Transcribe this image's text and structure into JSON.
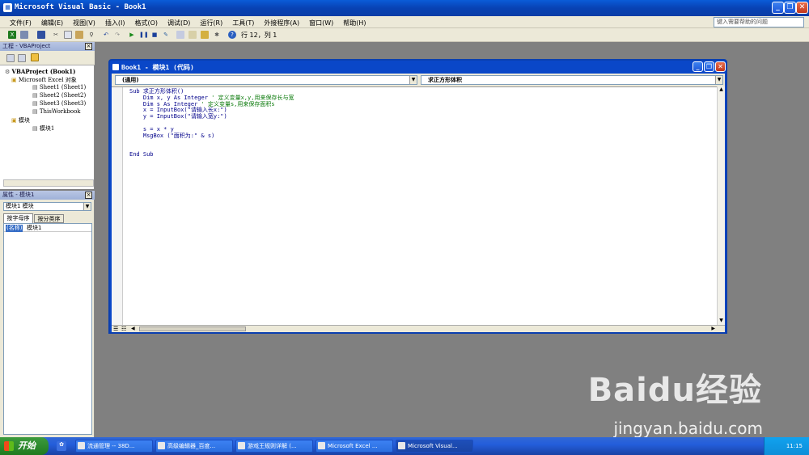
{
  "window": {
    "title": "Microsoft Visual Basic - Book1"
  },
  "menu": [
    "文件(F)",
    "编辑(E)",
    "视图(V)",
    "插入(I)",
    "格式(O)",
    "调试(D)",
    "运行(R)",
    "工具(T)",
    "外接程序(A)",
    "窗口(W)",
    "帮助(H)"
  ],
  "help_placeholder": "键入需要帮助的问题",
  "toolbar": {
    "cursor_pos": "行 12，列 1"
  },
  "project_pane": {
    "title": "工程 - VBAProject",
    "tree": [
      {
        "label": "VBAProject (Book1)",
        "level": 0
      },
      {
        "label": "Microsoft Excel 对象",
        "level": 1
      },
      {
        "label": "Sheet1 (Sheet1)",
        "level": 2
      },
      {
        "label": "Sheet2 (Sheet2)",
        "level": 2
      },
      {
        "label": "Sheet3 (Sheet3)",
        "level": 2
      },
      {
        "label": "ThisWorkbook",
        "level": 2
      },
      {
        "label": "模块",
        "level": 1
      },
      {
        "label": "模块1",
        "level": 2
      }
    ]
  },
  "props_pane": {
    "title": "属性 - 模块1",
    "selector": "模块1 模块",
    "tab_alpha": "按字母序",
    "tab_category": "按分类序",
    "row_name": "(名称)",
    "row_value": "模块1"
  },
  "code_window": {
    "title": "Book1 - 模块1 (代码)",
    "object_combo": "(通用)",
    "proc_combo": "求正方形体积",
    "lines": [
      {
        "code": "Sub 求正方形体积()",
        "comment": ""
      },
      {
        "code": "    Dim x, y As Integer ",
        "comment": "' 定义变量x,y,用来保存长与宽"
      },
      {
        "code": "    Dim s As Integer ",
        "comment": "' 定义变量s,用来保存面积s"
      },
      {
        "code": "    x = InputBox(\"请输入长x:\")",
        "comment": ""
      },
      {
        "code": "    y = InputBox(\"请输入宽y:\")",
        "comment": ""
      },
      {
        "code": "",
        "comment": ""
      },
      {
        "code": "    s = x * y",
        "comment": ""
      },
      {
        "code": "    MsgBox (\"面积为:\" & s)",
        "comment": ""
      },
      {
        "code": "",
        "comment": ""
      },
      {
        "code": "",
        "comment": ""
      },
      {
        "code": "End Sub",
        "comment": ""
      }
    ]
  },
  "watermark": {
    "brand": "Baidu经验",
    "url": "jingyan.baidu.com"
  },
  "taskbar": {
    "start": "开始",
    "tasks": [
      {
        "label": "流通管理 -- 38D...",
        "active": false
      },
      {
        "label": "高级编辑器_百度...",
        "active": false
      },
      {
        "label": "游戏王规则详解 (...",
        "active": false
      },
      {
        "label": "Microsoft Excel ...",
        "active": false
      },
      {
        "label": "Microsoft Visual...",
        "active": true
      }
    ],
    "clock": "11:15"
  }
}
